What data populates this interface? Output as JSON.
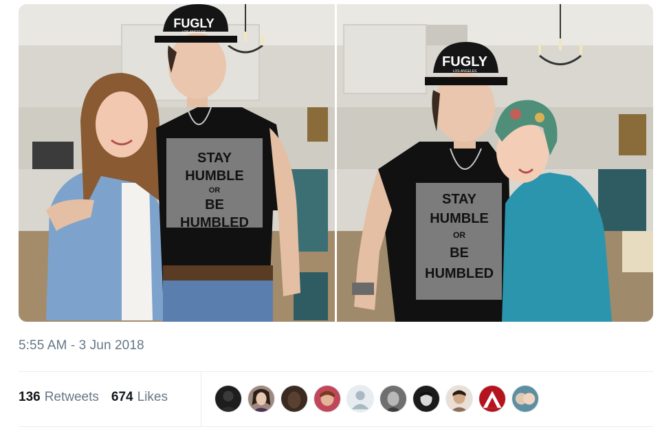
{
  "tweet": {
    "photos": [
      {
        "name": "photo-left",
        "cap_text": "FUGLY",
        "cap_subtext": "LOS ANGELES",
        "shirt_lines": [
          "STAY",
          "HUMBLE",
          "OR",
          "BE",
          "HUMBLED"
        ]
      },
      {
        "name": "photo-right",
        "cap_text": "FUGLY",
        "cap_subtext": "LOS ANGELES",
        "shirt_lines": [
          "STAY",
          "HUMBLE",
          "OR",
          "BE",
          "HUMBLED"
        ]
      }
    ],
    "time": "5:55 AM",
    "separator": "-",
    "date": "3 Jun 2018",
    "retweets": {
      "count": "136",
      "label": "Retweets"
    },
    "likes": {
      "count": "674",
      "label": "Likes"
    },
    "avatars": [
      {
        "icon": "avatar-1",
        "color": "#1d1d1d"
      },
      {
        "icon": "avatar-2",
        "color": "#a0887c"
      },
      {
        "icon": "avatar-3",
        "color": "#3b2a20"
      },
      {
        "icon": "avatar-4",
        "color": "#c0475a"
      },
      {
        "icon": "avatar-default",
        "color": "#ccd6dd"
      },
      {
        "icon": "avatar-6",
        "color": "#6f6f6f"
      },
      {
        "icon": "avatar-7",
        "color": "#1b1b1b"
      },
      {
        "icon": "avatar-8",
        "color": "#8e6b5a"
      },
      {
        "icon": "avatar-9",
        "color": "#b5141e"
      },
      {
        "icon": "avatar-10",
        "color": "#5e8fa0"
      }
    ]
  }
}
